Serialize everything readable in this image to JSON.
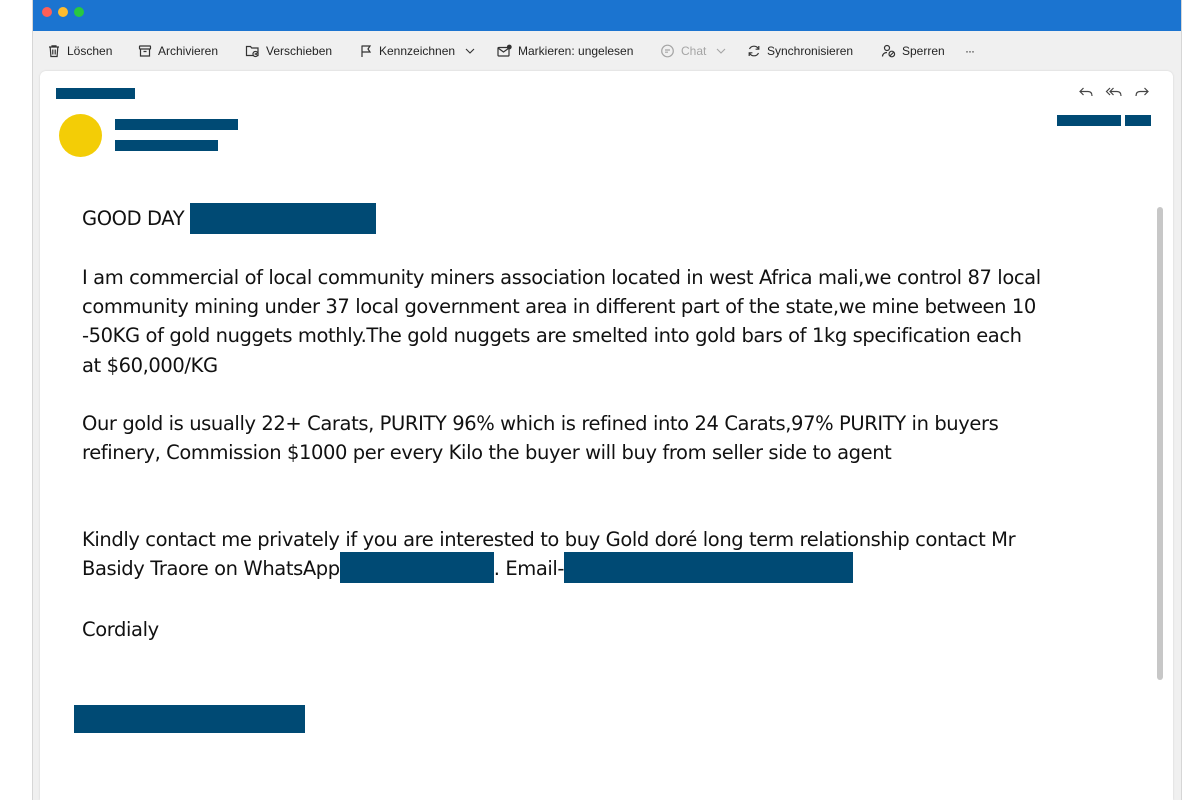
{
  "toolbar": {
    "delete_label": "Löschen",
    "archive_label": "Archivieren",
    "move_label": "Verschieben",
    "flag_label": "Kennzeichnen",
    "mark_unread_label": "Markieren: ungelesen",
    "chat_label": "Chat",
    "sync_label": "Synchronisieren",
    "block_label": "Sperren",
    "more_label": "···"
  },
  "email": {
    "greeting": "GOOD DAY",
    "paragraph1": "I am commercial of local community miners association located in west Africa mali,we control 87 local community mining under 37 local government area in different part of the state,we mine between 10 -50KG of gold nuggets mothly.The gold nuggets are smelted into gold bars of 1kg specification each at $60,000/KG",
    "paragraph2": "Our gold is usually 22+ Carats, PURITY 96% which is refined into 24 Carats,97% PURITY in buyers refinery, Commission $1000 per every Kilo the buyer will buy from seller side to agent",
    "paragraph3_part1": "Kindly contact me privately if you are interested to buy Gold doré long term relationship contact Mr Basidy Traore on WhatsApp",
    "paragraph3_part2": ". Email-",
    "closing": "Cordialy"
  },
  "colors": {
    "titlebar": "#1b74d0",
    "redaction": "#004a74",
    "avatar": "#f3cd06",
    "traffic_close": "#fe5f57",
    "traffic_min": "#febc2e",
    "traffic_max": "#28c840"
  },
  "icons": [
    "trash-icon",
    "archive-icon",
    "move-folder-icon",
    "flag-icon",
    "mail-unread-icon",
    "chat-icon",
    "sync-icon",
    "block-icon",
    "reply-icon",
    "reply-all-icon",
    "forward-icon"
  ]
}
